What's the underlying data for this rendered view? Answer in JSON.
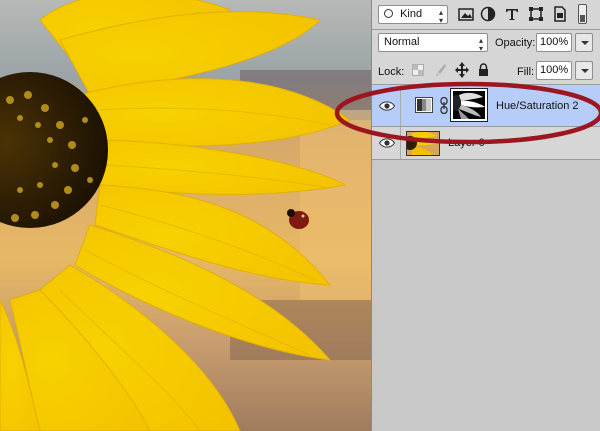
{
  "panel": {
    "filter": {
      "label": "Kind"
    },
    "filter_icons": [
      "image-filter-icon",
      "adjustment-filter-icon",
      "type-filter-icon",
      "shape-filter-icon",
      "smart-object-filter-icon",
      "filter-toggle-icon"
    ],
    "blend_mode": {
      "value": "Normal"
    },
    "opacity": {
      "label": "Opacity:",
      "value": "100%"
    },
    "lock": {
      "label": "Lock:"
    },
    "fill": {
      "label": "Fill:",
      "value": "100%"
    },
    "layers": [
      {
        "name": "Hue/Saturation 2",
        "type": "adjustment",
        "selected": true,
        "visible": true
      },
      {
        "name": "Layer 0",
        "type": "pixel",
        "selected": false,
        "visible": true
      }
    ],
    "selected_color": "#b5cdf8",
    "highlight_ellipse_color": "#9c1620"
  }
}
